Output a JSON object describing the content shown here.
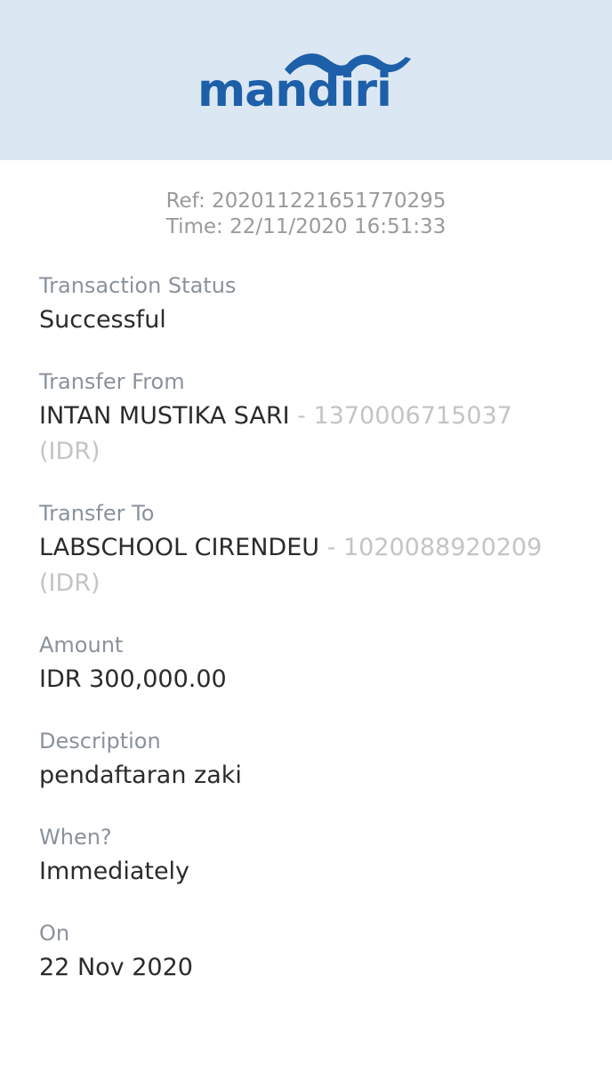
{
  "header": {
    "logo_text": "mandiri",
    "logo_color": "#1d5fa8",
    "background": "#dbe7f3"
  },
  "receipt": {
    "ref": "Ref: 202011221651770295",
    "time": "Time: 22/11/2020 16:51:33"
  },
  "fields": {
    "status": {
      "label": "Transaction Status",
      "value": "Successful"
    },
    "from": {
      "label": "Transfer From",
      "name": "INTAN MUSTIKA SARI",
      "account": " - 1370006715037 (IDR)"
    },
    "to": {
      "label": "Transfer To",
      "name": "LABSCHOOL CIRENDEU",
      "account": " - 1020088920209 (IDR)"
    },
    "amount": {
      "label": "Amount",
      "value": "IDR 300,000.00"
    },
    "description": {
      "label": "Description",
      "value": "pendaftaran zaki"
    },
    "when": {
      "label": "When?",
      "value": "Immediately"
    },
    "on": {
      "label": "On",
      "value": "22 Nov 2020"
    }
  }
}
